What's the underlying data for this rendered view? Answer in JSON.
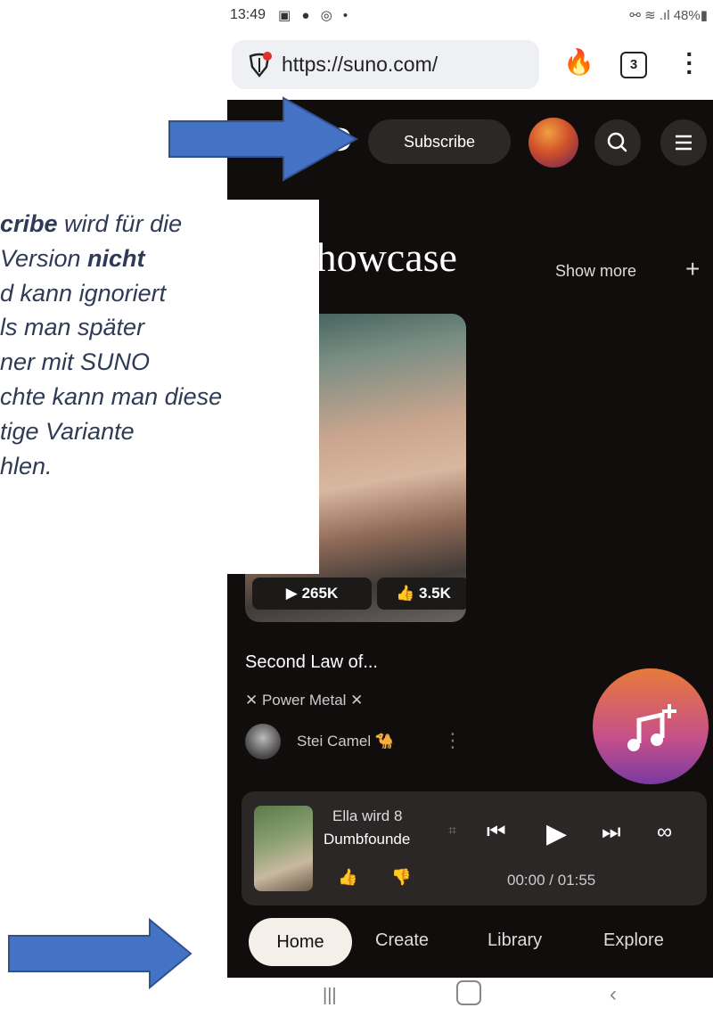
{
  "status_bar": {
    "time": "13:49",
    "battery": "48%"
  },
  "browser": {
    "url": "https://suno.com/",
    "tab_count": "3"
  },
  "header": {
    "logo_text": "SUNO",
    "subscribe_label": "Subscribe"
  },
  "showcase": {
    "title": "Showcase",
    "show_more_label": "Show more",
    "plus": "+"
  },
  "song": {
    "plays": "▶ 265K",
    "likes": "👍 3.5K",
    "title": "Second Law of...",
    "genre": "✕ Power Metal ✕",
    "artist": "Stei Camel 🐪"
  },
  "player": {
    "line1": "Ella wird 8",
    "line2": "Dumbfounde",
    "time": "00:00 / 01:55"
  },
  "nav": {
    "home": "Home",
    "create": "Create",
    "library": "Library",
    "explore": "Explore"
  },
  "annotation": {
    "l1_bold": "cribe",
    "l1": " wird für die",
    "l2": "Version ",
    "l2_bold": "nicht",
    "l3": "d kann ignoriert",
    "l4": "ls man später",
    "l5": "ner mit SUNO",
    "l6": "chte kann man diese",
    "l7": "tige Variante",
    "l8": "hlen."
  },
  "colors": {
    "app_bg": "#100d0c",
    "arrow_fill": "#4472c4",
    "arrow_stroke": "#2f528f",
    "annotation_text": "#2f3b54",
    "fab_top": "#e77a3a",
    "fab_bottom": "#7a3aa0"
  }
}
